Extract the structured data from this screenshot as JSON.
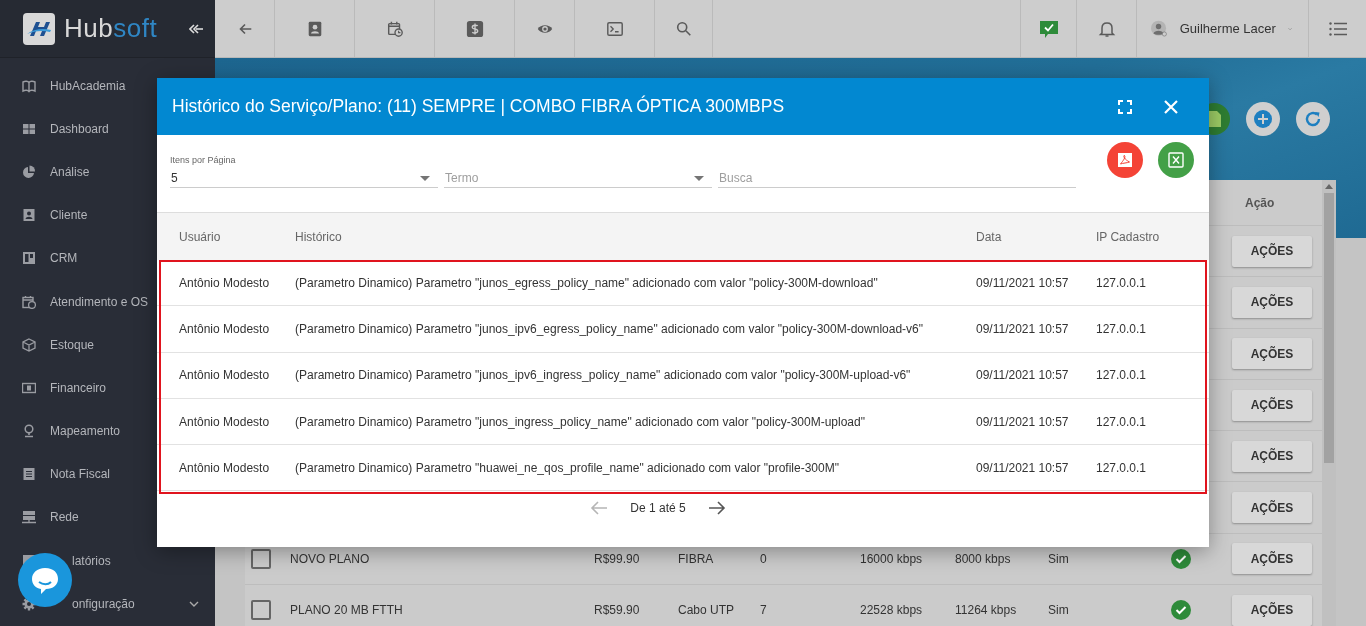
{
  "sidebar": {
    "brand": [
      "Hub",
      "soft"
    ],
    "items": [
      {
        "label": "HubAcademia"
      },
      {
        "label": "Dashboard"
      },
      {
        "label": "Análise"
      },
      {
        "label": "Cliente"
      },
      {
        "label": "CRM"
      },
      {
        "label": "Atendimento e OS"
      },
      {
        "label": "Estoque"
      },
      {
        "label": "Financeiro"
      },
      {
        "label": "Mapeamento"
      },
      {
        "label": "Nota Fiscal"
      },
      {
        "label": "Rede"
      },
      {
        "label": "latórios",
        "kind": "partial"
      },
      {
        "label": "onfiguração",
        "kind": "partial",
        "expandable": true
      }
    ]
  },
  "topbar": {
    "user": {
      "name": "Guilherme Lacer"
    }
  },
  "table": {
    "columns": [
      {
        "label": "Ação"
      }
    ],
    "rows": [
      {
        "action": "AÇÕES"
      },
      {
        "action": "AÇÕES"
      },
      {
        "action": "AÇÕES"
      },
      {
        "action": "AÇÕES"
      },
      {
        "action": "AÇÕES"
      },
      {
        "action": "AÇÕES"
      },
      {
        "checked": false,
        "column_2": "NOVO PLANO",
        "column_3": "R$99.90",
        "column_4": "FIBRA",
        "column_5": "0",
        "column_6": "16000 kbps",
        "column_7": "8000 kbps",
        "column_8": "Sim",
        "active": true,
        "action": "AÇÕES"
      },
      {
        "checked": false,
        "column_2": "PLANO 20 MB FTTH",
        "column_3": "R$59.90",
        "column_4": "Cabo UTP",
        "column_5": "7",
        "column_6": "22528 kbps",
        "column_7": "11264 kbps",
        "column_8": "Sim",
        "active": true,
        "action": "AÇÕES"
      }
    ]
  },
  "modal": {
    "title": "Histórico do Serviço/Plano: (11) SEMPRE | COMBO FIBRA ÓPTICA 300MBPS",
    "filters": [
      {
        "kind": "select",
        "label": "Itens por Página",
        "value": "5"
      },
      {
        "kind": "select",
        "placeholder": "Termo"
      },
      {
        "kind": "input",
        "placeholder": "Busca"
      }
    ],
    "columns": [
      "Usuário",
      "Histórico",
      "Data",
      "IP Cadastro"
    ],
    "highlight": true,
    "rows": [
      {
        "user": "Antônio Modesto",
        "history": "(Parametro Dinamico) Parametro \"junos_egress_policy_name\" adicionado com valor \"policy-300M-download\"",
        "date": "09/11/2021 10:57",
        "ip": "127.0.0.1"
      },
      {
        "user": "Antônio Modesto",
        "history": "(Parametro Dinamico) Parametro \"junos_ipv6_egress_policy_name\" adicionado com valor \"policy-300M-download-v6\"",
        "date": "09/11/2021 10:57",
        "ip": "127.0.0.1"
      },
      {
        "user": "Antônio Modesto",
        "history": "(Parametro Dinamico) Parametro \"junos_ipv6_ingress_policy_name\" adicionado com valor \"policy-300M-upload-v6\"",
        "date": "09/11/2021 10:57",
        "ip": "127.0.0.1"
      },
      {
        "user": "Antônio Modesto",
        "history": "(Parametro Dinamico) Parametro \"junos_ingress_policy_name\" adicionado com valor \"policy-300M-upload\"",
        "date": "09/11/2021 10:57",
        "ip": "127.0.0.1"
      },
      {
        "user": "Antônio Modesto",
        "history": "(Parametro Dinamico) Parametro \"huawei_ne_qos_profile_name\" adicionado com valor \"profile-300M\"",
        "date": "09/11/2021 10:57",
        "ip": "127.0.0.1"
      }
    ],
    "pagination": {
      "summary": "De 1 até 5",
      "previous_disabled": true,
      "next_disabled": false
    }
  }
}
